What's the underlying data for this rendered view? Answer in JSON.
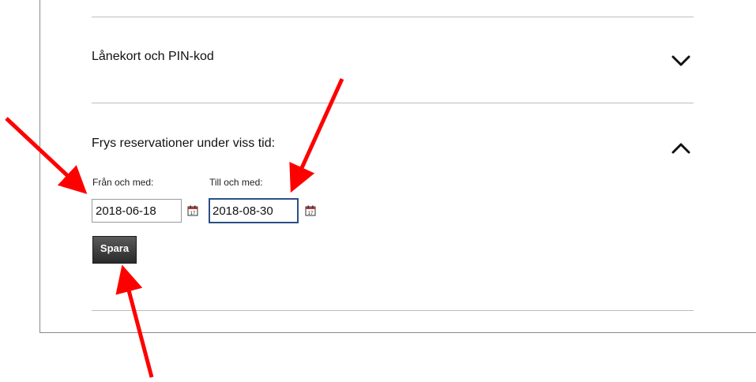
{
  "sections": [
    {
      "title": "Lånekort och PIN-kod",
      "expanded": false,
      "icon": "chevron-down-icon"
    },
    {
      "title": "Frys reservationer under viss tid:",
      "expanded": true,
      "icon": "chevron-up-icon"
    }
  ],
  "freeze": {
    "from_label": "Från och med:",
    "from_value": "2018-06-18",
    "to_label": "Till och med:",
    "to_value": "2018-08-30",
    "calendar_icon": "calendar-icon",
    "calendar_day": "17",
    "save_label": "Spara"
  },
  "colors": {
    "annotation_arrow": "#ff0000",
    "focus_border": "#2b4f86",
    "calendar_accent": "#b33a3a"
  }
}
